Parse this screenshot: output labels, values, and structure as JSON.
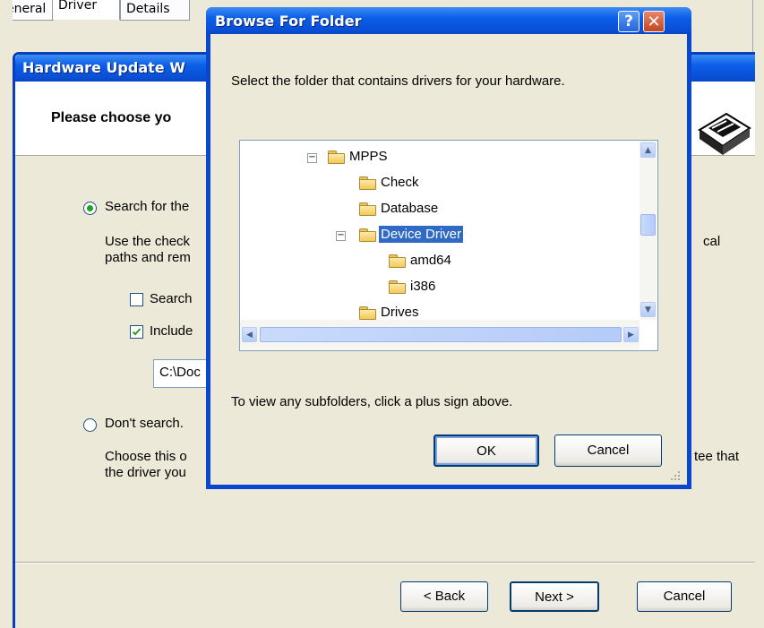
{
  "properties_window": {
    "tabs": [
      "eneral",
      "Driver",
      "Details"
    ]
  },
  "wizard": {
    "title": "Hardware Update W",
    "heading": "Please choose yo",
    "option_search": {
      "label": "Search for the",
      "desc_line1": "Use the check",
      "desc_line2": "paths and rem",
      "desc_right": "cal",
      "checkbox_search": "Search",
      "checkbox_include": "Include",
      "path_value": "C:\\Doc",
      "selected": true
    },
    "option_dont_search": {
      "label": "Don't search.",
      "desc_line1": "Choose this o",
      "desc_line2": "the driver you",
      "desc_right": "tee that",
      "selected": false
    },
    "buttons": {
      "back": "< Back",
      "next": "Next >",
      "cancel": "Cancel"
    }
  },
  "browse_dialog": {
    "title": "Browse For Folder",
    "instruction": "Select the folder that contains drivers for your hardware.",
    "tree": {
      "items": [
        {
          "label": "MPPS",
          "expander": "−"
        },
        {
          "label": "Check"
        },
        {
          "label": "Database"
        },
        {
          "label": "Device Driver",
          "expander": "−",
          "selected": true
        },
        {
          "label": "amd64"
        },
        {
          "label": "i386"
        },
        {
          "label": "Drives"
        }
      ]
    },
    "hint": "To view any subfolders, click a plus sign above.",
    "ok_label": "OK",
    "cancel_label": "Cancel",
    "help_glyph": "?",
    "close_glyph": "✕"
  }
}
